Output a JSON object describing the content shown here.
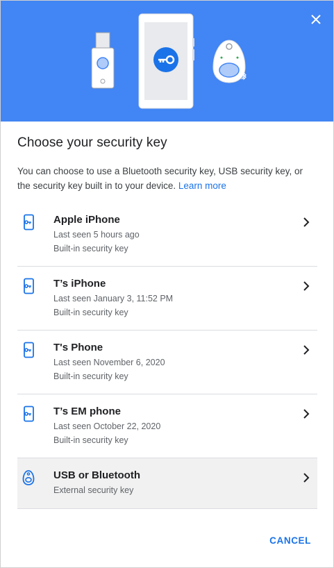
{
  "dialog": {
    "title": "Choose your security key",
    "description": "You can choose to use a Bluetooth security key, USB security key, or the security key built in to your device.",
    "learn_more": "Learn more",
    "cancel": "CANCEL"
  },
  "devices": [
    {
      "name": "Apple iPhone",
      "line1": "Last seen 5 hours ago",
      "line2": "Built-in security key",
      "icon": "phone-key-icon"
    },
    {
      "name": "T’s iPhone",
      "line1": "Last seen January 3, 11:52 PM",
      "line2": "Built-in security key",
      "icon": "phone-key-icon"
    },
    {
      "name": "T's Phone",
      "line1": "Last seen November 6, 2020",
      "line2": "Built-in security key",
      "icon": "phone-key-icon"
    },
    {
      "name": "T’s EM phone",
      "line1": "Last seen October 22, 2020",
      "line2": "Built-in security key",
      "icon": "phone-key-icon"
    },
    {
      "name": "USB or Bluetooth",
      "line1": "External security key",
      "icon": "bluetooth-key-icon"
    }
  ],
  "colors": {
    "header": "#4285f4",
    "accent": "#1a73e8",
    "selected_row": "#f1f1f1"
  }
}
